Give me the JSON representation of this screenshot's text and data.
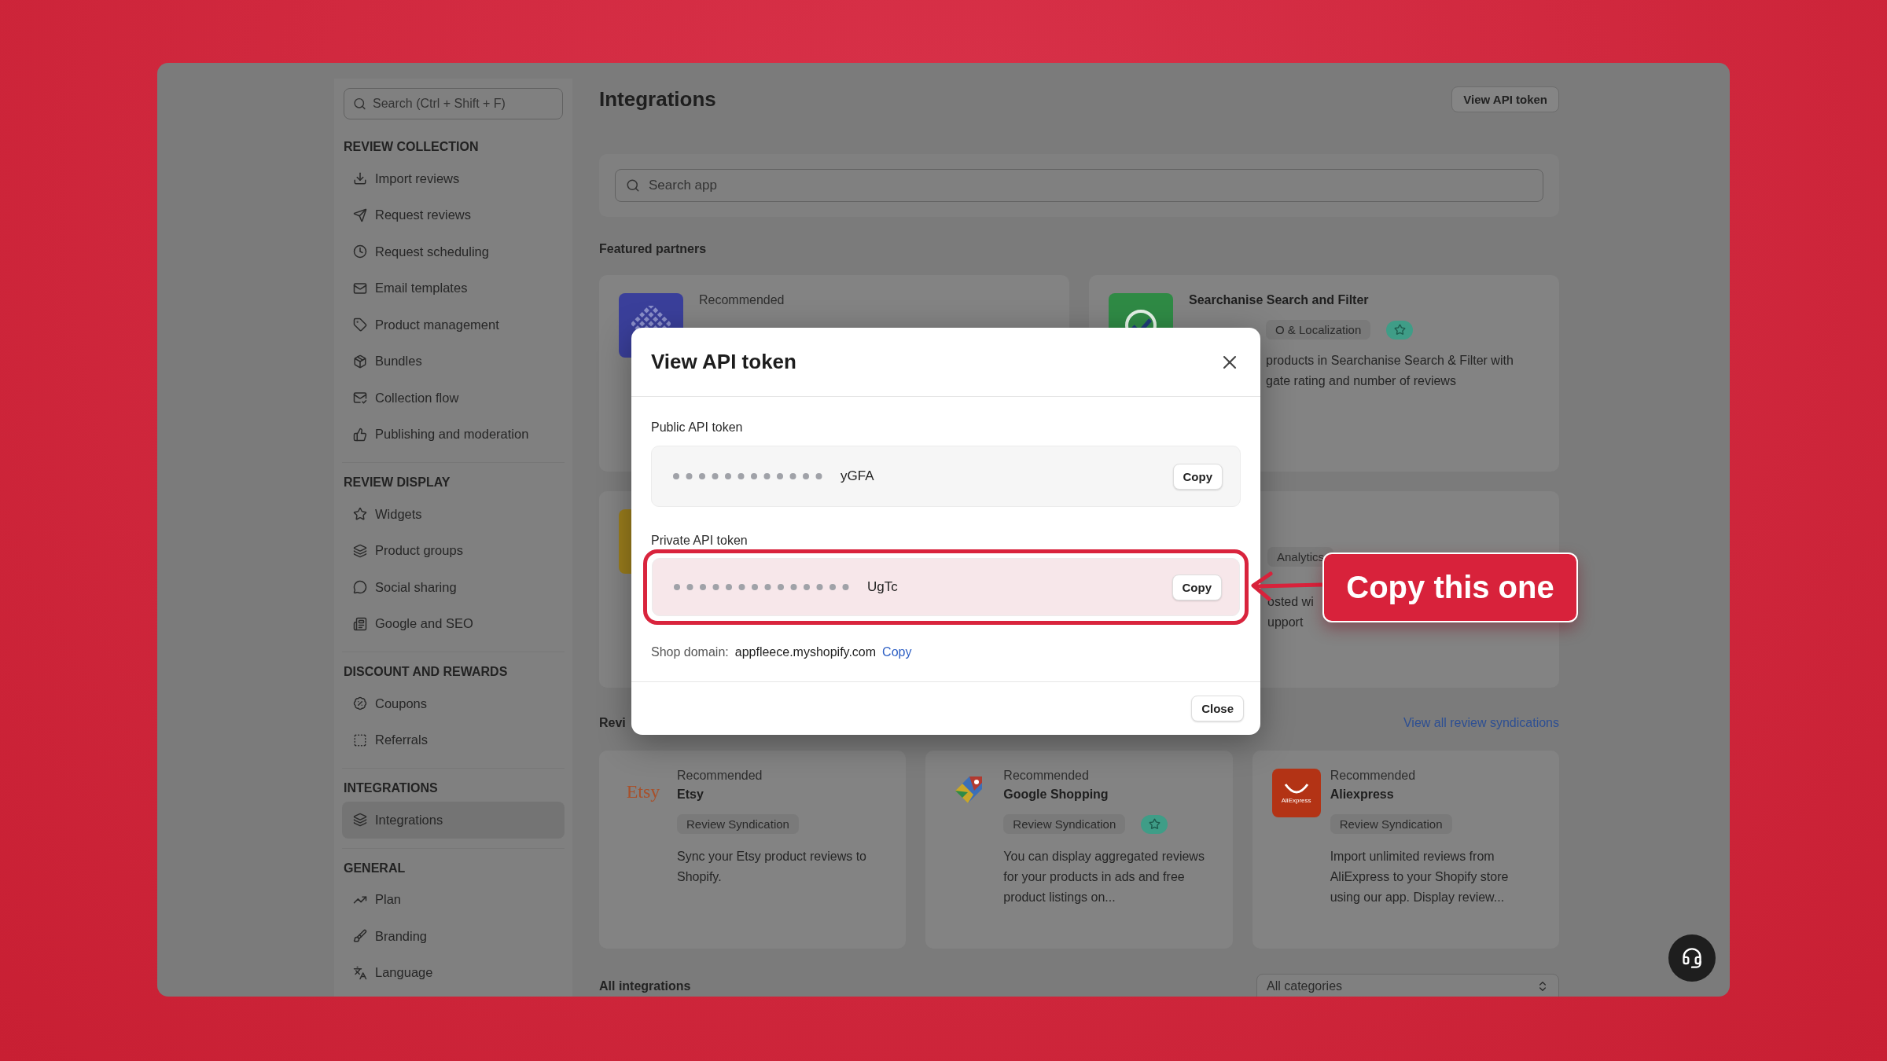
{
  "sidebar": {
    "search": {
      "placeholder": "Search (Ctrl + Shift + F)"
    },
    "sections": [
      {
        "title": "REVIEW COLLECTION",
        "items": [
          {
            "label": "Import reviews",
            "selected": false
          },
          {
            "label": "Request reviews",
            "selected": false
          },
          {
            "label": "Request scheduling",
            "selected": false
          },
          {
            "label": "Email templates",
            "selected": false
          },
          {
            "label": "Product management",
            "selected": false
          },
          {
            "label": "Bundles",
            "selected": false
          },
          {
            "label": "Collection flow",
            "selected": false
          },
          {
            "label": "Publishing and moderation",
            "selected": false
          }
        ]
      },
      {
        "title": "REVIEW DISPLAY",
        "items": [
          {
            "label": "Widgets",
            "selected": false
          },
          {
            "label": "Product groups",
            "selected": false
          },
          {
            "label": "Social sharing",
            "selected": false
          },
          {
            "label": "Google and SEO",
            "selected": false
          }
        ]
      },
      {
        "title": "DISCOUNT AND REWARDS",
        "items": [
          {
            "label": "Coupons",
            "selected": false
          },
          {
            "label": "Referrals",
            "selected": false
          }
        ]
      },
      {
        "title": "INTEGRATIONS",
        "items": [
          {
            "label": "Integrations",
            "selected": true
          }
        ]
      },
      {
        "title": "GENERAL",
        "items": [
          {
            "label": "Plan",
            "selected": false
          },
          {
            "label": "Branding",
            "selected": false
          },
          {
            "label": "Language",
            "selected": false
          }
        ]
      }
    ]
  },
  "header": {
    "title": "Integrations",
    "button": "View API token"
  },
  "search": {
    "placeholder": "Search app"
  },
  "featured": {
    "title": "Featured partners",
    "cards": [
      {
        "kind": "grid",
        "eyebrow": "Recommended"
      },
      {
        "kind": "check",
        "title": "Searchanise Search and Filter",
        "tag": "O & Localization",
        "starred": true,
        "lines": [
          "products in Searchanise Search & Filter with",
          "gate rating and number of reviews"
        ]
      },
      {
        "kind": "square"
      },
      {
        "kind": "text",
        "tag": "Analytics",
        "starred": false,
        "lines": [
          "osted wi",
          "upport"
        ]
      }
    ]
  },
  "syndications": {
    "heading": "Revi",
    "link": "View all review syndications",
    "cards": [
      {
        "logo": {
          "kind": "wordmark",
          "text": "Etsy"
        },
        "eyebrow": "Recommended",
        "title": "Etsy",
        "tag": "Review Syndication",
        "starred": false,
        "description": "Sync your Etsy product reviews to Shopify."
      },
      {
        "logo": {
          "kind": "google"
        },
        "eyebrow": "Recommended",
        "title": "Google Shopping",
        "tag": "Review Syndication",
        "starred": true,
        "description": "You can display aggregated reviews for your products in ads and free product listings on..."
      },
      {
        "logo": {
          "kind": "smile",
          "text": "AliExpress"
        },
        "eyebrow": "Recommended",
        "title": "Aliexpress",
        "tag": "Review Syndication",
        "starred": false,
        "description": "Import unlimited reviews from AliExpress to your Shopify store using our app. Display review..."
      }
    ]
  },
  "all_integrations": {
    "title": "All integrations",
    "category_select": {
      "value": "All categories"
    }
  },
  "modal": {
    "title": "View API token",
    "tokens": [
      {
        "label": "Public API token",
        "suffix": "yGFA",
        "copy": "Copy",
        "highlighted": false
      },
      {
        "label": "Private API token",
        "suffix": "UgTc",
        "copy": "Copy",
        "highlighted": true
      }
    ],
    "shop_domain": {
      "label": "Shop domain:",
      "value": "appfleece.myshopify.com",
      "copy": "Copy"
    },
    "close": "Close"
  },
  "callout": {
    "text": "Copy this one"
  }
}
